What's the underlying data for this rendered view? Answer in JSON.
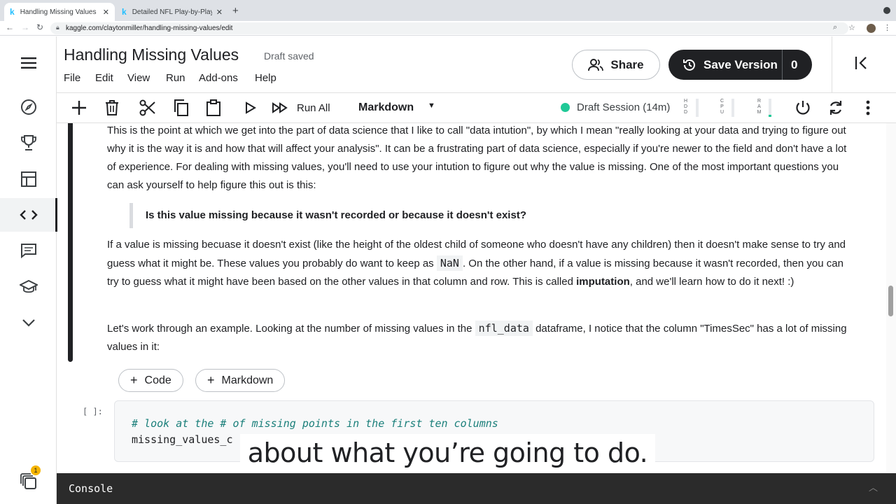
{
  "browser": {
    "tabs": [
      {
        "title": "Handling Missing Values | Kaggle",
        "active": true
      },
      {
        "title": "Detailed NFL Play-by-Play Data",
        "active": false
      }
    ],
    "url": "kaggle.com/claytonmiller/handling-missing-values/edit"
  },
  "header": {
    "title": "Handling Missing Values",
    "status": "Draft saved",
    "menu": [
      "File",
      "Edit",
      "View",
      "Run",
      "Add-ons",
      "Help"
    ],
    "share_label": "Share",
    "save_label": "Save Version",
    "save_count": "0"
  },
  "toolbar": {
    "run_all": "Run All",
    "cell_type": "Markdown",
    "session": "Draft Session (14m)",
    "meters": [
      {
        "label": "HDD",
        "level": 0.0
      },
      {
        "label": "CPU",
        "level": 0.0
      },
      {
        "label": "RAM",
        "level": 0.1
      }
    ]
  },
  "notebook": {
    "p1": "This is the point at which we get into the part of data science that I like to call \"data intution\", by which I mean \"really looking at your data and trying to figure out why it is the way it is and how that will affect your analysis\". It can be a frustrating part of data science, especially if you're newer to the field and don't have a lot of experience. For dealing with missing values, you'll need to use your intution to figure out why the value is missing. One of the most important questions you can ask yourself to help figure this out is this:",
    "quote": "Is this value missing because it wasn't recorded or because it doesn't exist?",
    "p2_a": "If a value is missing becuase it doesn't exist (like the height of the oldest child of someone who doesn't have any children) then it doesn't make sense to try and guess what it might be. These values you probably do want to keep as ",
    "p2_code": "NaN",
    "p2_b": ". On the other hand, if a value is missing because it wasn't recorded, then you can try to guess what it might have been based on the other values in that column and row. This is called ",
    "p2_bold": "imputation",
    "p2_c": ", and we'll learn how to do it next! :)",
    "p3_a": "Let's work through an example. Looking at the number of missing values in the ",
    "p3_code": "nfl_data",
    "p3_b": " dataframe, I notice that the column \"TimesSec\" has a lot of missing values in it:",
    "add_code_label": "Code",
    "add_markdown_label": "Markdown",
    "cell_prompt": "[ ]:",
    "code_comment": "# look at the # of missing points in the first ten columns",
    "code_line2": "missing_values_c"
  },
  "subtitle": "about what you’re going to do.",
  "console": {
    "title": "Console"
  },
  "rail": {
    "badge": "1"
  }
}
